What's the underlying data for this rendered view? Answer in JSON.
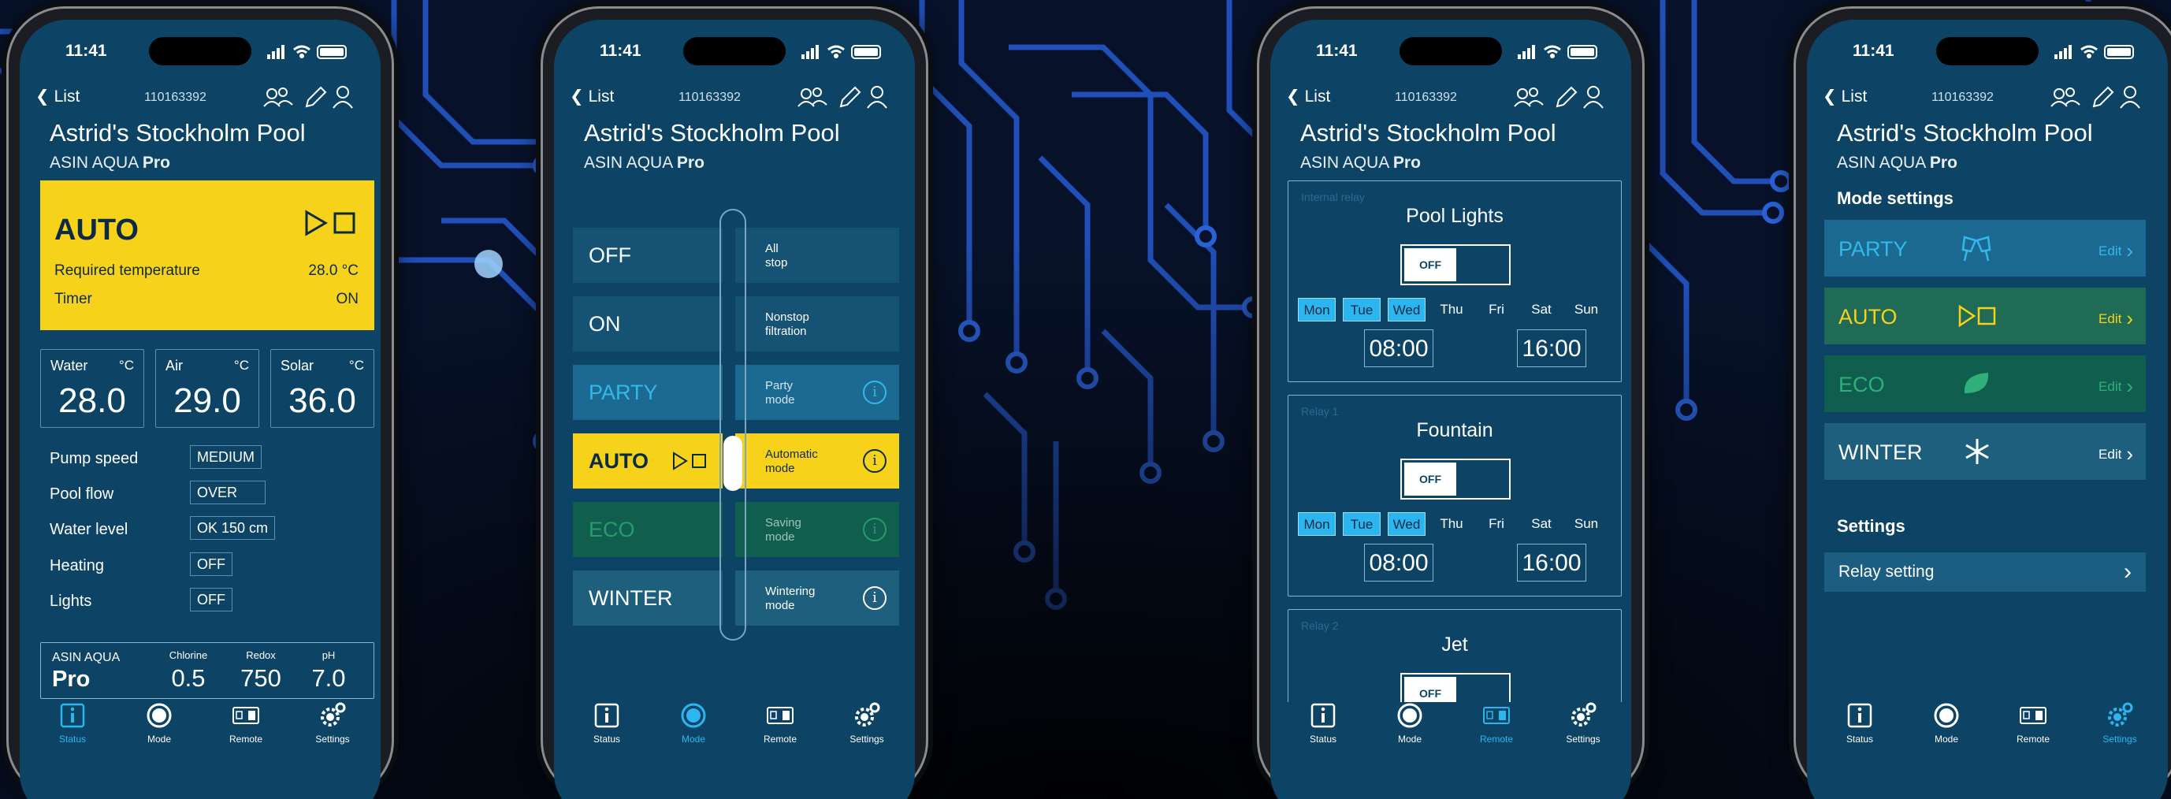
{
  "colors": {
    "screen": "#0d4466",
    "auto_yellow": "#f7d21a",
    "accent_blue": "#2bb6f0",
    "party": "#1c5d82",
    "eco": "#0f6a5a",
    "auto_set": "#1f6b55",
    "winter": "#1e5f7e"
  },
  "status": {
    "time": "11:41"
  },
  "nav": {
    "back_label": "List",
    "serial": "110163392"
  },
  "pool": {
    "title": "Astrid's Stockholm Pool",
    "brand_prefix": "ASIN AQUA",
    "brand_suffix": "Pro"
  },
  "tabs": [
    {
      "label": "Status",
      "icon": "info-icon"
    },
    {
      "label": "Mode",
      "icon": "mode-dot-icon"
    },
    {
      "label": "Remote",
      "icon": "remote-icon"
    },
    {
      "label": "Settings",
      "icon": "gears-icon"
    }
  ],
  "status_screen": {
    "mode": "AUTO",
    "rows": [
      {
        "label": "Required temperature",
        "value": "28.0 °C"
      },
      {
        "label": "Timer",
        "value": "ON"
      }
    ],
    "temps": [
      {
        "label": "Water",
        "unit": "°C",
        "value": "28.0"
      },
      {
        "label": "Air",
        "unit": "°C",
        "value": "29.0"
      },
      {
        "label": "Solar",
        "unit": "°C",
        "value": "36.0"
      }
    ],
    "params": [
      {
        "label": "Pump speed",
        "value": "MEDIUM"
      },
      {
        "label": "Pool flow",
        "value": "OVER"
      },
      {
        "label": "Water level",
        "value": "OK  150  cm"
      },
      {
        "label": "Heating",
        "value": "OFF"
      },
      {
        "label": "Lights",
        "value": "OFF"
      }
    ],
    "chem": {
      "brand": "ASIN AQUA",
      "pro": "Pro",
      "items": [
        {
          "label": "Chlorine",
          "value": "0.5"
        },
        {
          "label": "Redox",
          "value": "750"
        },
        {
          "label": "pH",
          "value": "7.0"
        }
      ]
    }
  },
  "mode_screen": {
    "modes": [
      {
        "label": "OFF",
        "desc": "All\nstop",
        "info": false
      },
      {
        "label": "ON",
        "desc": "Nonstop\nfiltration",
        "info": false
      },
      {
        "label": "PARTY",
        "desc": "Party\nmode",
        "info": true
      },
      {
        "label": "AUTO",
        "desc": "Automatic\nmode",
        "info": true
      },
      {
        "label": "ECO",
        "desc": "Saving\nmode",
        "info": true
      },
      {
        "label": "WINTER",
        "desc": "Wintering\nmode",
        "info": true
      }
    ],
    "selected": "AUTO"
  },
  "remote_screen": {
    "relays": [
      {
        "tag": "Internal relay",
        "name": "Pool Lights",
        "toggle": "OFF",
        "start": "08:00",
        "end": "16:00"
      },
      {
        "tag": "Relay 1",
        "name": "Fountain",
        "toggle": "OFF",
        "start": "08:00",
        "end": "16:00"
      },
      {
        "tag": "Relay 2",
        "name": "Jet",
        "toggle": "OFF"
      }
    ],
    "days": [
      {
        "d": "Mon",
        "on": true
      },
      {
        "d": "Tue",
        "on": true
      },
      {
        "d": "Wed",
        "on": true
      },
      {
        "d": "Thu",
        "on": false
      },
      {
        "d": "Fri",
        "on": false
      },
      {
        "d": "Sat",
        "on": false
      },
      {
        "d": "Sun",
        "on": false
      }
    ]
  },
  "settings_screen": {
    "mode_settings_title": "Mode settings",
    "modes": [
      {
        "label": "PARTY",
        "icon": "cheers-icon",
        "edit": "Edit"
      },
      {
        "label": "AUTO",
        "icon": "play-stop-icon",
        "edit": "Edit"
      },
      {
        "label": "ECO",
        "icon": "leaf-icon",
        "edit": "Edit"
      },
      {
        "label": "WINTER",
        "icon": "snowflake-icon",
        "edit": "Edit"
      }
    ],
    "settings_title": "Settings",
    "relay_setting": "Relay setting"
  }
}
